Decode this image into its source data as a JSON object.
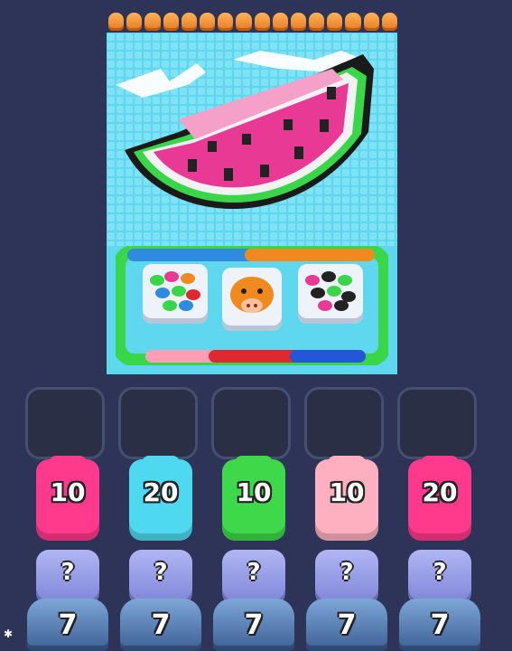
{
  "board": {
    "art": "watermelon-pixel-art",
    "colors": {
      "background": "#5fd7ee",
      "sky_white": "#ffffff",
      "flesh_pink": "#e83a95",
      "flesh_light": "#f5a0c8",
      "seed_black": "#222222",
      "rind_white": "#f2f2f2",
      "rind_green": "#3ad64a",
      "outline_black": "#1a1a1a"
    }
  },
  "containers": [
    {
      "name": "jelly-bean-bowl-left",
      "icon": "colorful-jelly-beans-icon"
    },
    {
      "name": "pig-figure-center",
      "icon": "orange-pig-icon"
    },
    {
      "name": "jelly-bean-bowl-right",
      "icon": "dark-jelly-beans-icon"
    }
  ],
  "tray_slots": 5,
  "pieces": [
    {
      "count": "10",
      "color": "#ff3a8c",
      "icon": "pink-block-icon"
    },
    {
      "count": "20",
      "color": "#4fd9f0",
      "icon": "cyan-block-icon"
    },
    {
      "count": "10",
      "color": "#3fd84a",
      "icon": "green-block-icon"
    },
    {
      "count": "10",
      "color": "#ffb0c0",
      "icon": "light-pink-block-icon"
    },
    {
      "count": "20",
      "color": "#ff3a8c",
      "icon": "pink-block-icon"
    }
  ],
  "mystery": [
    {
      "label": "?"
    },
    {
      "label": "?"
    },
    {
      "label": "?"
    },
    {
      "label": "?"
    },
    {
      "label": "?"
    }
  ],
  "cannons": [
    {
      "count": "7"
    },
    {
      "count": "7"
    },
    {
      "count": "7"
    },
    {
      "count": "7"
    },
    {
      "count": "7"
    }
  ]
}
